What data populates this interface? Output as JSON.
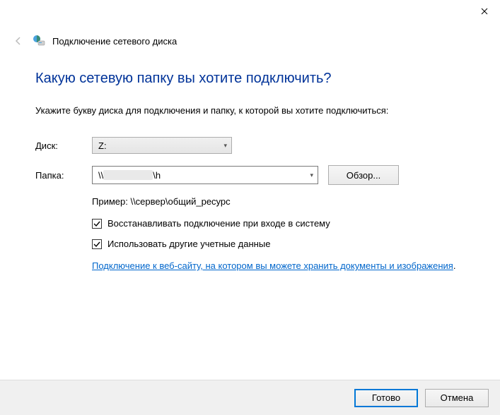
{
  "window": {
    "title": "Подключение сетевого диска"
  },
  "wizard": {
    "heading": "Какую сетевую папку вы хотите подключить?",
    "instruction": "Укажите букву диска для подключения и папку, к которой вы хотите подключиться:",
    "drive_label": "Диск:",
    "drive_value": "Z:",
    "folder_label": "Папка:",
    "folder_prefix": "\\\\",
    "folder_suffix": "\\h",
    "browse_label": "Обзор...",
    "example_text": "Пример: \\\\сервер\\общий_ресурс",
    "reconnect_label": "Восстанавливать подключение при входе в систему",
    "other_creds_label": "Использовать другие учетные данные",
    "website_link": "Подключение к веб-сайту, на котором вы можете хранить документы и изображения",
    "link_period": "."
  },
  "buttons": {
    "finish": "Готово",
    "cancel": "Отмена"
  }
}
